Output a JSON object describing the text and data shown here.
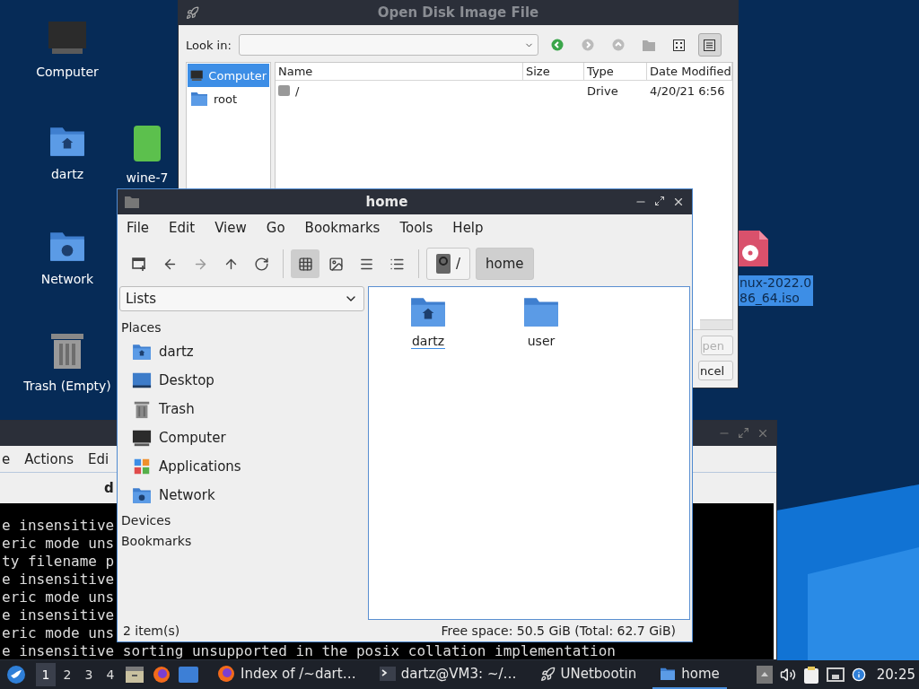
{
  "desktop_icons": [
    {
      "lines": [
        "Computer"
      ],
      "kind": "computer",
      "selected": false
    },
    {
      "lines": [
        "dartz"
      ],
      "kind": "home",
      "selected": false
    },
    {
      "lines": [
        "wine-7"
      ],
      "kind": "green",
      "selected": false
    },
    {
      "lines": [
        "Network"
      ],
      "kind": "network",
      "selected": false
    },
    {
      "lines": [
        "Trash (Empty)"
      ],
      "kind": "trash",
      "selected": false
    },
    {
      "lines": [
        "nux-2022.0",
        "86_64.iso"
      ],
      "kind": "disc",
      "selected": true
    }
  ],
  "terminal": {
    "menu": [
      "e",
      "Actions",
      "Edi"
    ],
    "title": "d",
    "lines": [
      "e insensitive",
      "eric mode uns",
      "ty filename p",
      "e insensitive",
      "eric mode uns",
      "e insensitive",
      "eric mode uns",
      "e insensitive sorting unsupported in the posix collation implementation"
    ]
  },
  "dialog": {
    "title": "Open Disk Image File",
    "look_in_label": "Look in:",
    "sidebar": [
      {
        "label": "Computer",
        "kind": "computer",
        "selected": true
      },
      {
        "label": "root",
        "kind": "folder",
        "selected": false
      }
    ],
    "columns": [
      "Name",
      "Size",
      "Type",
      "Date Modified"
    ],
    "rows": [
      {
        "name": "/",
        "type": "Drive",
        "date_modified": "4/20/21 6:56"
      }
    ],
    "buttons": [
      {
        "label": "pen",
        "disabled": true
      },
      {
        "label": "ncel",
        "disabled": false
      }
    ]
  },
  "file_manager": {
    "title": "home",
    "menu": [
      "File",
      "Edit",
      "View",
      "Go",
      "Bookmarks",
      "Tools",
      "Help"
    ],
    "views": [
      {
        "kind": "icons",
        "selected": true
      },
      {
        "kind": "thumbnails",
        "selected": false
      },
      {
        "kind": "compact",
        "selected": false
      },
      {
        "kind": "list",
        "selected": false
      }
    ],
    "path": [
      {
        "label": "/",
        "kind": "root",
        "selected": false
      },
      {
        "label": "home",
        "kind": "folder",
        "selected": true
      }
    ],
    "side_panel": {
      "mode": "Lists",
      "sections": [
        {
          "title": "Places",
          "items": [
            {
              "label": "dartz",
              "kind": "home"
            },
            {
              "label": "Desktop",
              "kind": "desktop"
            },
            {
              "label": "Trash",
              "kind": "trash"
            },
            {
              "label": "Computer",
              "kind": "computer"
            },
            {
              "label": "Applications",
              "kind": "applications"
            },
            {
              "label": "Network",
              "kind": "network"
            }
          ]
        },
        {
          "title": "Devices"
        },
        {
          "title": "Bookmarks"
        }
      ]
    },
    "files": [
      {
        "name": "dartz",
        "kind": "home",
        "focused": true
      },
      {
        "name": "user",
        "kind": "folder",
        "focused": false
      }
    ],
    "status": {
      "count": "2 item(s)",
      "free_space": "Free space: 50.5 GiB (Total: 62.7 GiB)"
    }
  },
  "taskbar": {
    "workspaces": [
      {
        "label": "1",
        "selected": true
      },
      {
        "label": "2",
        "selected": false
      },
      {
        "label": "3",
        "selected": false
      },
      {
        "label": "4",
        "selected": false
      }
    ],
    "tasks": [
      {
        "label": "Index of /~dart…",
        "kind": "browser",
        "selected": false
      },
      {
        "label": "dartz@VM3: ~/…",
        "kind": "terminal",
        "selected": false
      },
      {
        "label": "UNetbootin",
        "kind": "unetbootin",
        "selected": false
      },
      {
        "label": "home",
        "kind": "folder",
        "selected": true
      }
    ],
    "clock": "20:25"
  }
}
